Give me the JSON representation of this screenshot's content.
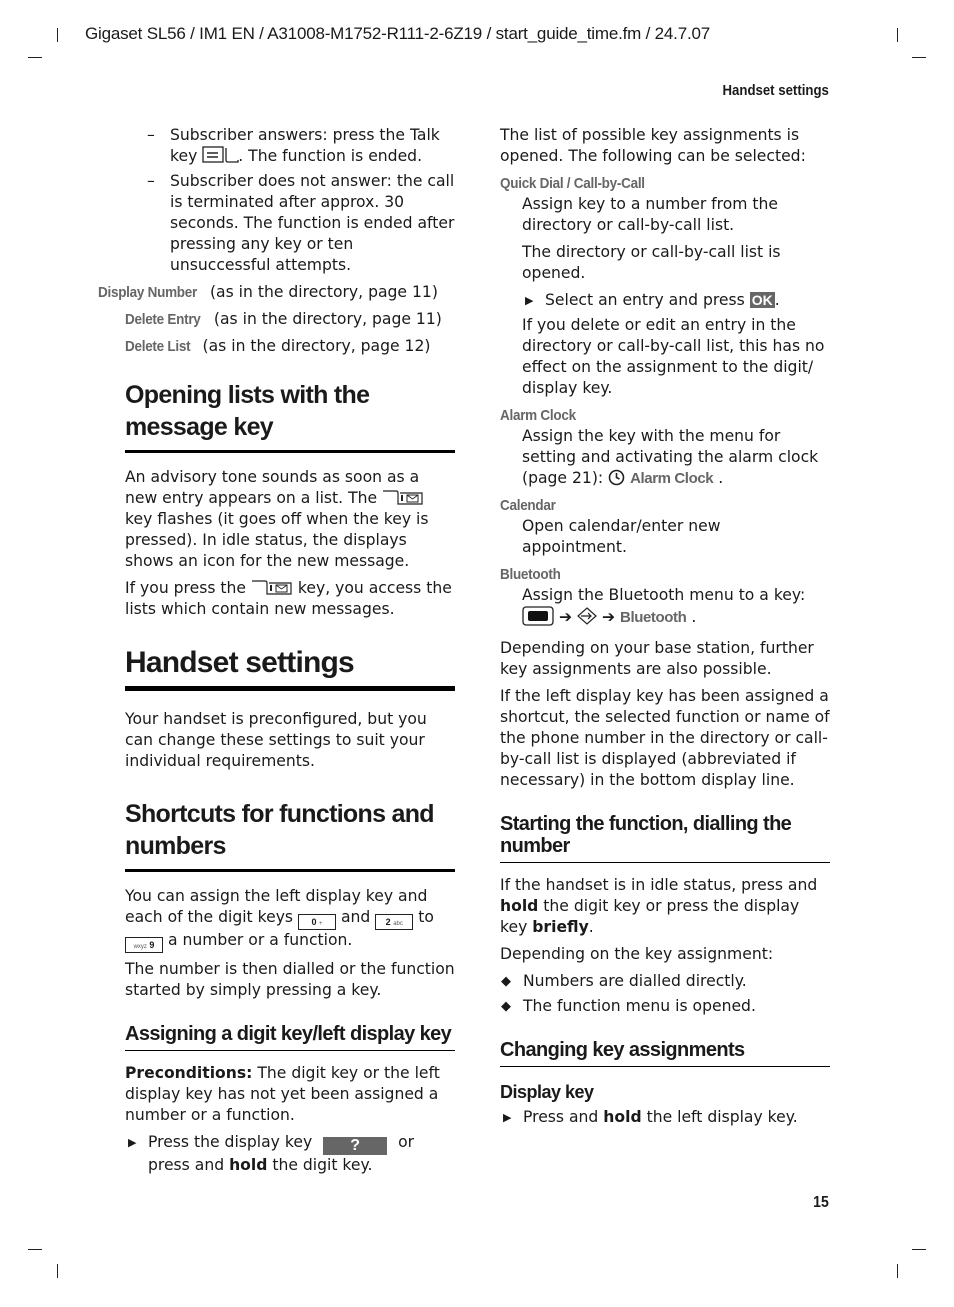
{
  "header": {
    "meta": "Gigaset SL56 / IM1 EN / A31008-M1752-R111-2-6Z19 / start_guide_time.fm / 24.7.07",
    "running_title": "Handset settings"
  },
  "left": {
    "dash_items": [
      {
        "pre": "Subscriber answers: press the Talk key ",
        "icon": "talk-key-icon",
        "post": ". The function is ended."
      },
      {
        "text": "Subscriber does not answer: the call is terminated after approx. 30 seconds. The function is ended after pressing any key or ten unsuccessful attempts."
      }
    ],
    "menu_refs": [
      {
        "label": "Display Number",
        "text": " (as in the directory, page 11)"
      },
      {
        "label": "Delete Entry",
        "text": " (as in the directory, page 11)"
      },
      {
        "label": "Delete List",
        "text": " (as in the directory, page 12)"
      }
    ],
    "section1": {
      "title": "Opening lists with the message key",
      "p1_pre": "An advisory tone sounds as soon as a new entry appears on a list. The ",
      "p1_post": " key flashes (it goes off when the key is pressed). In idle status, the displays shows an icon for the new message.",
      "p2_pre": "If you press the ",
      "p2_post": " key, you access the lists which contain new messages."
    },
    "section2": {
      "title": "Handset settings",
      "p1": "Your handset is preconfigured, but you can change these settings to suit your individual requirements."
    },
    "section3": {
      "title": "Shortcuts for functions and numbers",
      "p1_pre": "You can assign the left display key and each of the digit keys ",
      "key0": "0",
      "key0_sub": "+",
      "p1_and": " and ",
      "key2": "2",
      "key2_sub": "abc",
      "p1_to": " to ",
      "key9": "9",
      "key9_sub": "wxyz",
      "p1_post": " a number or a function.",
      "p2": "The number is then dialled or the function started by simply pressing a key."
    },
    "section4": {
      "title": "Assigning a digit key/left display key",
      "precond_label": "Preconditions:",
      "precond_text": " The digit key or the left display key has not yet been assigned a number or a function.",
      "step_pre": "Press the display key ",
      "softkey": "?",
      "step_mid": " or press and ",
      "step_bold": "hold",
      "step_post": " the digit key."
    }
  },
  "right": {
    "intro": "The list of possible key assignments is opened. The following can be selected:",
    "options": {
      "quick_dial": {
        "label": "Quick Dial / Call-by-Call",
        "p1": "Assign key to a number from the directory or call-by-call list.",
        "p2": "The directory or call-by-call list is opened.",
        "step_pre": "Select an entry and press ",
        "ok": "OK",
        "step_post": ".",
        "p3": "If you delete or edit an entry in the directory or call-by-call list, this has no effect on the assignment to the digit/ display key."
      },
      "alarm": {
        "label": "Alarm Clock",
        "p1_pre": "Assign the key with the menu for setting and activating the alarm clock (page 21): ",
        "menu": "Alarm Clock",
        "p1_post": " ."
      },
      "calendar": {
        "label": "Calendar",
        "p1": "Open calendar/enter new appointment."
      },
      "bluetooth": {
        "label": "Bluetooth",
        "p1": "Assign the Bluetooth menu to a key:",
        "arrow": "➔",
        "menu": "Bluetooth",
        "post": " ."
      }
    },
    "p_base": "Depending on your base station, further key assignments are also possible.",
    "p_left": "If the left display key has been assigned a shortcut, the selected function or name of the phone number in the directory or call-by-call list is displayed (abbreviated if necessary) in the bottom display line.",
    "section_start": {
      "title": "Starting the function, dialling the number",
      "p1_a": "If the handset is in idle status, press and ",
      "p1_hold": "hold",
      "p1_b": " the digit key or press the display key ",
      "p1_briefly": "briefly",
      "p1_c": ".",
      "p2": "Depending on the key assignment:",
      "bullets": [
        "Numbers are dialled directly.",
        "The function menu is opened."
      ]
    },
    "section_change": {
      "title": "Changing key assignments",
      "sub": "Display key",
      "step_pre": "Press and ",
      "step_bold": "hold",
      "step_post": " the left display key."
    }
  },
  "footer": {
    "page_number": "15"
  }
}
